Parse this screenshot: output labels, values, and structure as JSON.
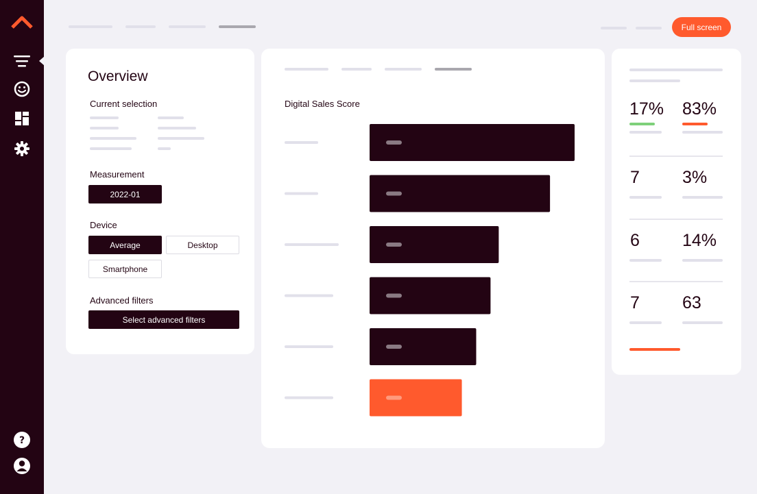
{
  "toolbar": {
    "fullscreen_label": "Full screen"
  },
  "sidebar": {
    "icons": [
      "logo-chevron-icon",
      "menu-filter-icon",
      "smiley-icon",
      "dashboard-icon",
      "gear-icon",
      "help-icon",
      "user-icon"
    ]
  },
  "overview": {
    "title": "Overview",
    "current_selection_label": "Current selection",
    "measurement_label": "Measurement",
    "measurement_value": "2022-01",
    "device_label": "Device",
    "device_options": [
      "Average",
      "Desktop",
      "Smartphone"
    ],
    "device_selected": "Average",
    "advanced_filters_label": "Advanced filters",
    "advanced_filters_button": "Select advanced filters"
  },
  "chart_data": {
    "type": "bar",
    "orientation": "horizontal",
    "title": "Digital Sales Score",
    "values": [
      100,
      88,
      63,
      59,
      52,
      45
    ],
    "highlight_index": 5,
    "colors": {
      "bar": "#230413",
      "highlight": "#ff5a2d"
    }
  },
  "stats": {
    "row1": {
      "left": "17%",
      "right": "83%",
      "left_accent": "#7ed07a",
      "right_accent": "#ff5a2d"
    },
    "row2": {
      "left": "7",
      "right": "3%"
    },
    "row3": {
      "left": "6",
      "right": "14%"
    },
    "row4": {
      "left": "7",
      "right": "63"
    },
    "footer_accent": "#ff5a2d"
  }
}
